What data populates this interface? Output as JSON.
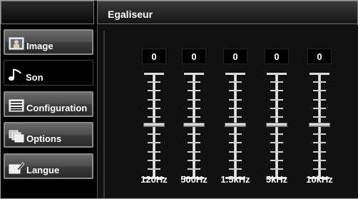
{
  "sidebar": {
    "items": [
      {
        "label": "Image",
        "icon": "picture-icon",
        "active": false
      },
      {
        "label": "Son",
        "icon": "music-note-icon",
        "active": true
      },
      {
        "label": "Configuration",
        "icon": "list-icon",
        "active": false
      },
      {
        "label": "Options",
        "icon": "stacked-pages-icon",
        "active": false
      },
      {
        "label": "Langue",
        "icon": "pencil-icon",
        "active": false
      }
    ]
  },
  "main": {
    "title": "Egaliseur",
    "bands": [
      {
        "freq": "120Hz",
        "value": "0"
      },
      {
        "freq": "500Hz",
        "value": "0"
      },
      {
        "freq": "1.5kHz",
        "value": "0"
      },
      {
        "freq": "5kHz",
        "value": "0"
      },
      {
        "freq": "10kHz",
        "value": "0"
      }
    ]
  },
  "colors": {
    "accent": "#ffffff",
    "background": "#000000"
  }
}
